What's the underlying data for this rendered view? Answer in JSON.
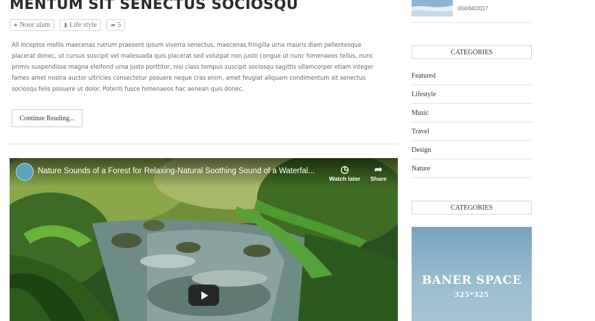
{
  "post": {
    "title": "MENTUM SIT SENECTUS SOCIOSQU",
    "author": "Noor alam",
    "category": "Life style",
    "comments": "5",
    "excerpt": "All inceptos mollis maecenas rutrum praesent ipsum viverra senectus, maecenas fringilla urna mauris diam pellentesque placerat donec, ut cursus suscipit vel malesuada quis placerat sed volutpat non justo congue ut nunc himenaeos tellus, nunc primis suspendisse magna eleifend urna justo porttitor, nisi class tempus suscipit sociosqu sagittis ullamcorper etiam integer fames amet nostra auctor ultricies consectetur posuere neque cras enim, amet feugiat aliquam condimentum sit senectus sociosqu felis posuere ut dolor. Potenti fusce himenaeos hac aenean quis donec.",
    "read_more": "Continue Reading..."
  },
  "video": {
    "title": "Nature Sounds of a Forest for Relaxing-Natural Soothing Sound of a Waterfal...",
    "watch_later": "Watch later",
    "share": "Share"
  },
  "sidebar": {
    "recent_date": "004/04/2017",
    "categories_title": "CATEGORIES",
    "categories": [
      "Featured",
      "Lifestyle",
      "Music",
      "Travel",
      "Design",
      "Nature"
    ],
    "second_title": "CATEGORIES",
    "banner_text": "BANER SPACE",
    "banner_size": "325*325"
  }
}
